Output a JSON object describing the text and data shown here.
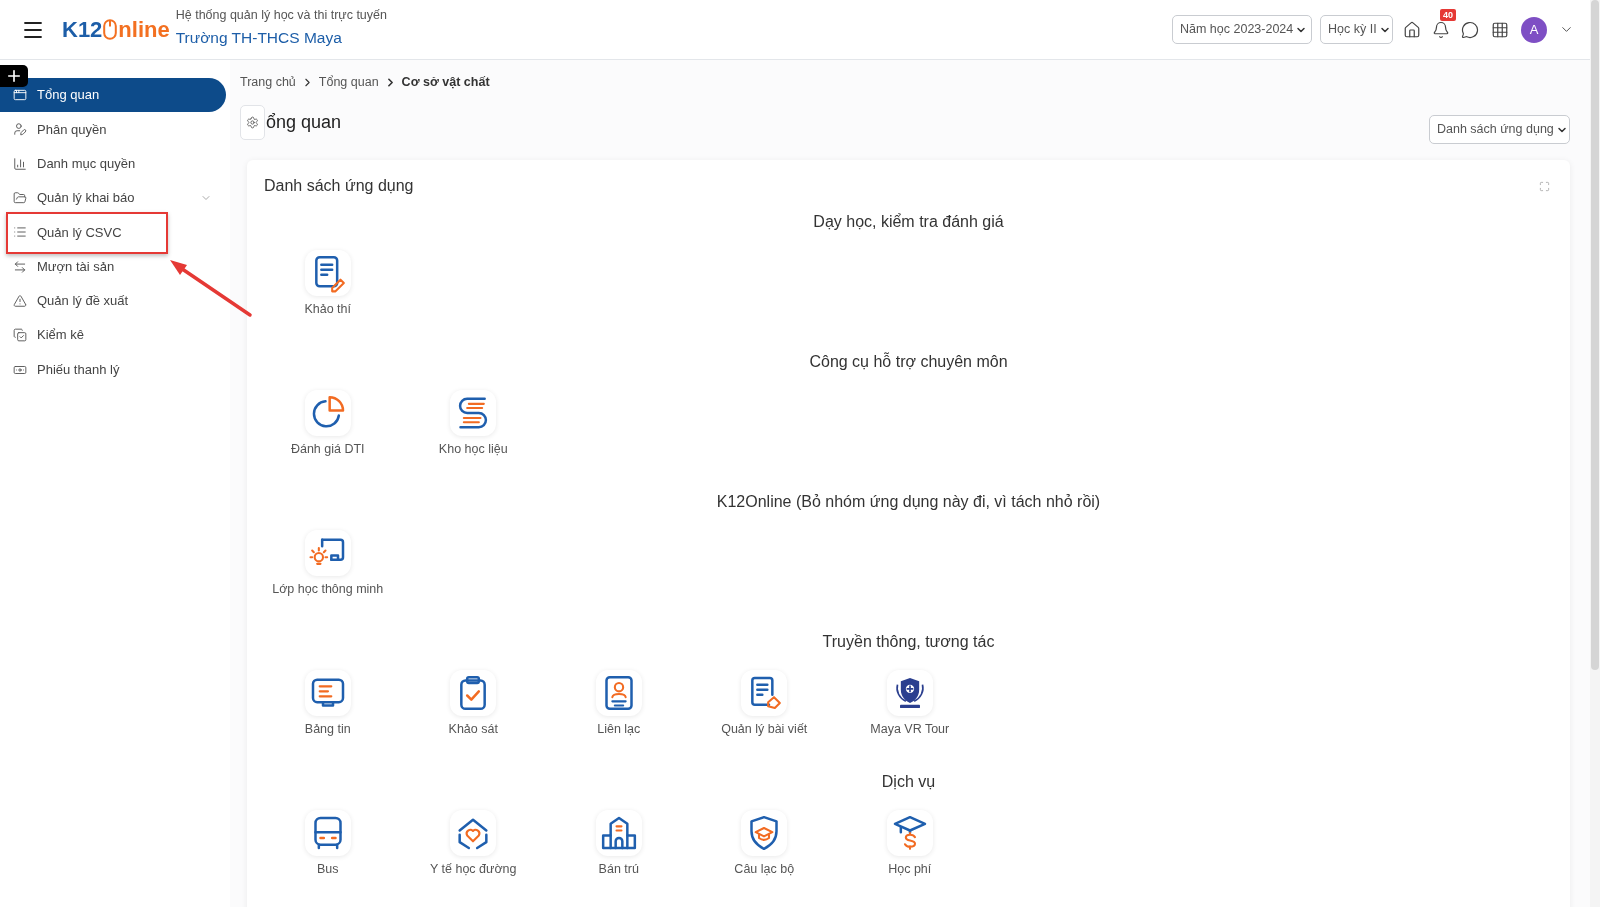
{
  "header": {
    "logo": {
      "lead": "K12",
      "tail": "nline"
    },
    "subtitle": "Hệ thống quản lý học và thi trực tuyến",
    "school": "Trường TH-THCS Maya",
    "selects": [
      {
        "value": "Năm học 2023-2024"
      },
      {
        "value": "Học kỳ II"
      }
    ],
    "notifications": {
      "badge": "40"
    },
    "avatar": {
      "initial": "A"
    }
  },
  "sidebar": {
    "items": [
      {
        "label": "Tổng quan",
        "kind": "link",
        "selected": true,
        "highlighted": false
      },
      {
        "label": "Phân quyền",
        "kind": "link",
        "selected": false,
        "highlighted": false
      },
      {
        "label": "Danh mục quyền",
        "kind": "link",
        "selected": false,
        "highlighted": false
      },
      {
        "label": "Quản lý khai báo",
        "kind": "group",
        "expanded": false,
        "selected": false,
        "highlighted": false
      },
      {
        "label": "Quản lý CSVC",
        "kind": "link",
        "selected": false,
        "highlighted": true
      },
      {
        "label": "Mượn tài sản",
        "kind": "link",
        "selected": false,
        "highlighted": false
      },
      {
        "label": "Quản lý đề xuất",
        "kind": "link",
        "selected": false,
        "highlighted": false
      },
      {
        "label": "Kiểm kê",
        "kind": "link",
        "selected": false,
        "highlighted": false
      },
      {
        "label": "Phiếu thanh lý",
        "kind": "link",
        "selected": false,
        "highlighted": false
      }
    ]
  },
  "breadcrumb": [
    {
      "label": "Trang chủ",
      "current": false
    },
    {
      "label": "Tổng quan",
      "current": false
    },
    {
      "label": "Cơ sở vật chất",
      "current": true
    }
  ],
  "page": {
    "title": "ổng quan",
    "view_select": {
      "value": "Danh sách ứng dụng"
    }
  },
  "card": {
    "title": "Danh sách ứng dụng",
    "sections": [
      {
        "title": "Dạy học, kiểm tra đánh giá",
        "apps": [
          {
            "label": "Khảo thí"
          }
        ]
      },
      {
        "title": "Công cụ hỗ trợ chuyên môn",
        "apps": [
          {
            "label": "Đánh giá DTI"
          },
          {
            "label": "Kho học liệu"
          }
        ]
      },
      {
        "title": "K12Online (Bỏ nhóm ứng dụng này đi, vì tách nhỏ rồi)",
        "apps": [
          {
            "label": "Lớp học thông minh"
          }
        ]
      },
      {
        "title": "Truyền thông, tương tác",
        "apps": [
          {
            "label": "Bảng tin"
          },
          {
            "label": "Khảo sát"
          },
          {
            "label": "Liên lạc"
          },
          {
            "label": "Quản lý bài viết"
          },
          {
            "label": "Maya VR Tour"
          }
        ]
      },
      {
        "title": "Dịch vụ",
        "apps": [
          {
            "label": "Bus"
          },
          {
            "label": "Y tế học đường"
          },
          {
            "label": "Bán trú"
          },
          {
            "label": "Câu lạc bộ"
          },
          {
            "label": "Học phí"
          }
        ]
      }
    ]
  }
}
